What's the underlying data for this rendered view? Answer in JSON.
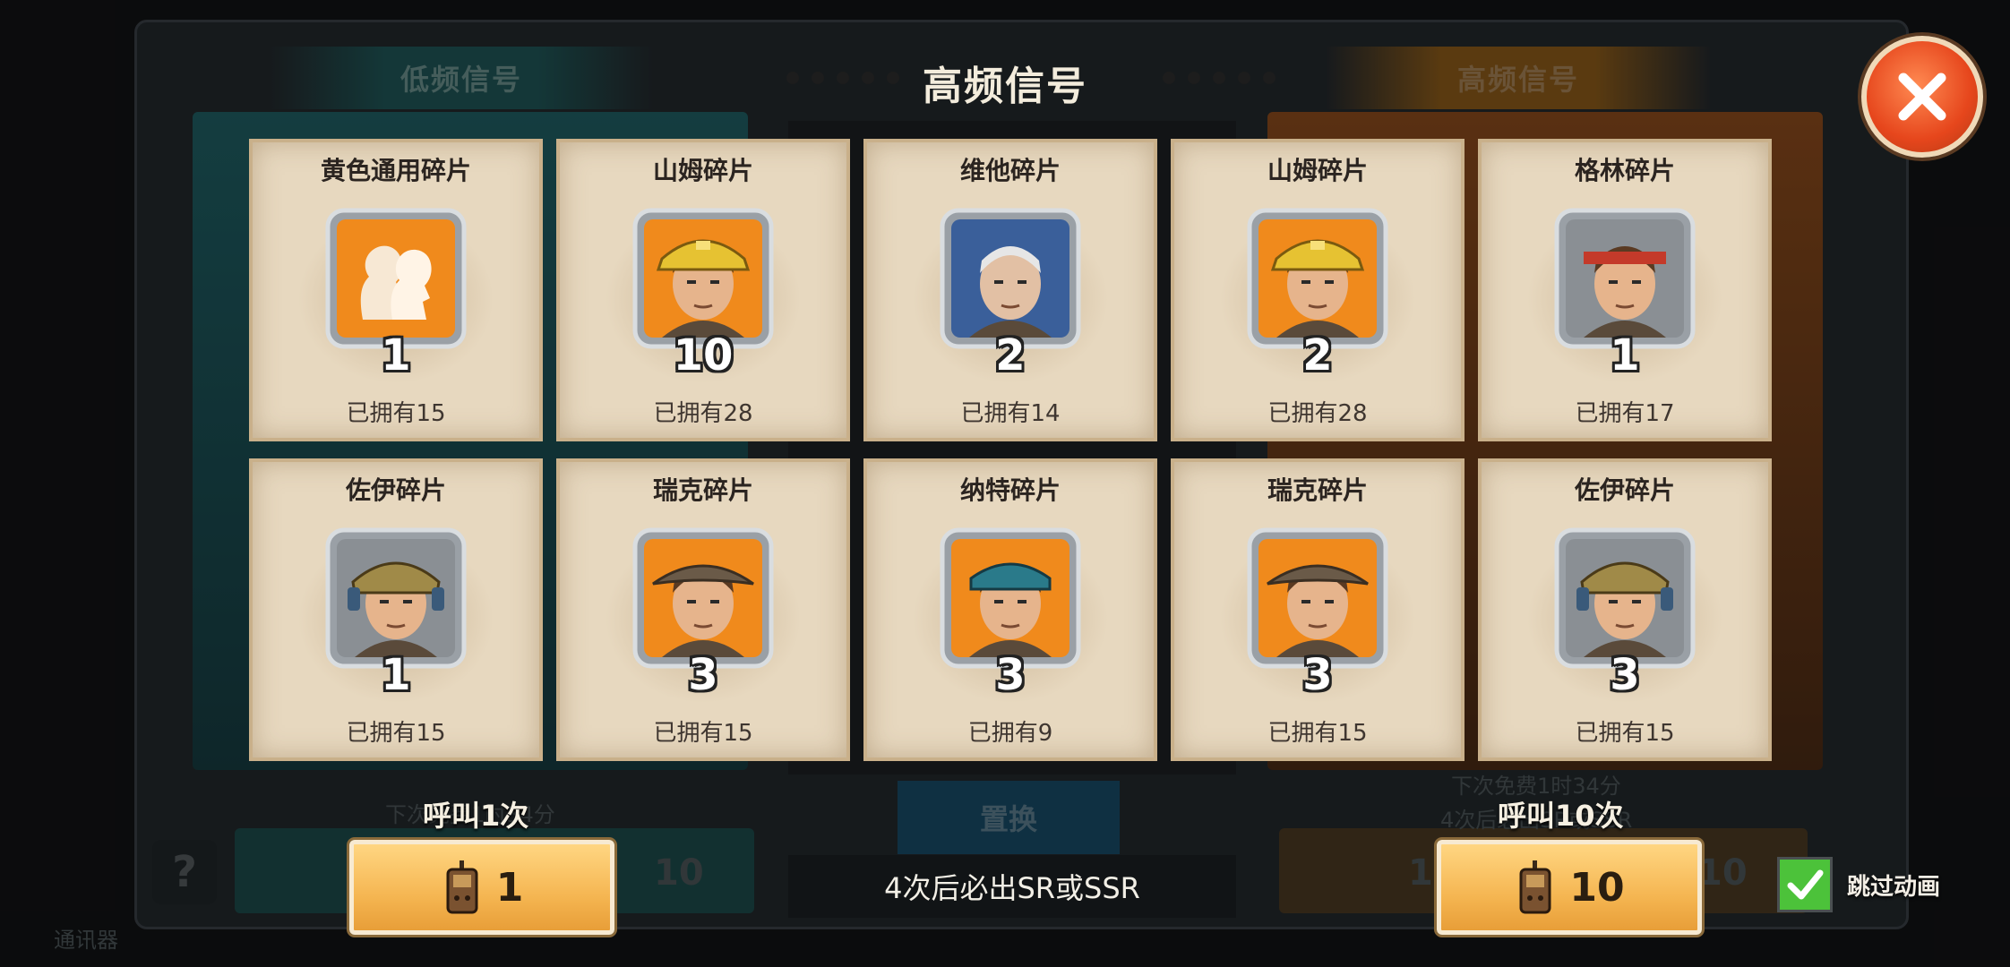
{
  "background": {
    "tab_left": "低频信号",
    "tab_right": "高频信号",
    "replace_label": "置换",
    "free_timer_left": "下次免费1时34分",
    "free_timer_right": "下次免费1时34分",
    "guarantee_hint_right": "4次后必出SR或SSR",
    "cost_left_1": "1",
    "cost_left_10": "10",
    "cost_right_1": "1",
    "cost_right_10": "10",
    "footer_left": "通讯器",
    "help_icon_label": "?"
  },
  "modal": {
    "title": "高频信号",
    "close_icon": "close-icon"
  },
  "cards": [
    {
      "name": "黄色通用碎片",
      "qty": "1",
      "owned": "已拥有15",
      "portrait": "generic-shard",
      "bg": "#f08a1c"
    },
    {
      "name": "山姆碎片",
      "qty": "10",
      "owned": "已拥有28",
      "portrait": "sam",
      "bg": "#f08a1c"
    },
    {
      "name": "维他碎片",
      "qty": "2",
      "owned": "已拥有14",
      "portrait": "vita",
      "bg": "#3a5f9a"
    },
    {
      "name": "山姆碎片",
      "qty": "2",
      "owned": "已拥有28",
      "portrait": "sam",
      "bg": "#f08a1c"
    },
    {
      "name": "格林碎片",
      "qty": "1",
      "owned": "已拥有17",
      "portrait": "green",
      "bg": "#8a8f94"
    },
    {
      "name": "佐伊碎片",
      "qty": "1",
      "owned": "已拥有15",
      "portrait": "zoe",
      "bg": "#8a8f94"
    },
    {
      "name": "瑞克碎片",
      "qty": "3",
      "owned": "已拥有15",
      "portrait": "rick",
      "bg": "#f08a1c"
    },
    {
      "name": "纳特碎片",
      "qty": "3",
      "owned": "已拥有9",
      "portrait": "nate",
      "bg": "#f08a1c"
    },
    {
      "name": "瑞克碎片",
      "qty": "3",
      "owned": "已拥有15",
      "portrait": "rick",
      "bg": "#f08a1c"
    },
    {
      "name": "佐伊碎片",
      "qty": "3",
      "owned": "已拥有15",
      "portrait": "zoe",
      "bg": "#8a8f94"
    }
  ],
  "actions": {
    "call_once_label": "呼叫1次",
    "call_once_cost": "1",
    "call_ten_label": "呼叫10次",
    "call_ten_cost": "10",
    "guarantee": "4次后必出SR或SSR",
    "skip_animation_label": "跳过动画",
    "skip_animation_checked": true
  },
  "colors": {
    "close": "#e6461c",
    "call_button": "#f5b652",
    "checkbox": "#4cc23a"
  }
}
